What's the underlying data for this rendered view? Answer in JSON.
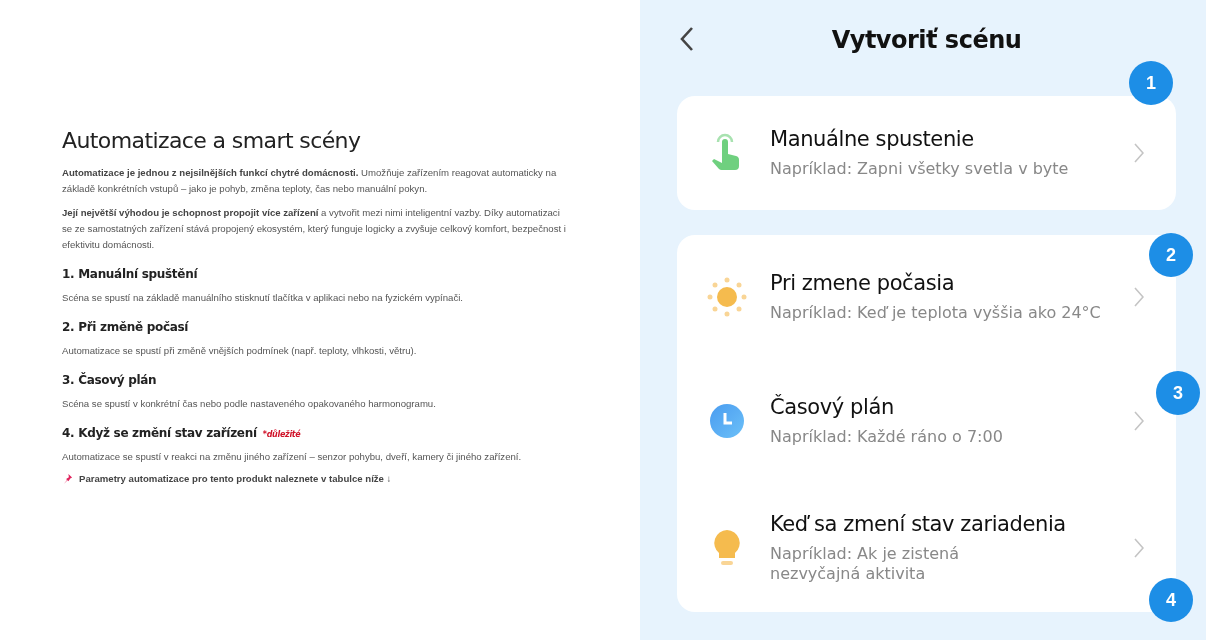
{
  "article": {
    "title": "Automatizace a smart scény",
    "paragraphs": [
      "**Automatizace je jednou z nejsilnějších funkcí chytré domácnosti.** Umožňuje zařízením reagovat automaticky na základě konkrétních vstupů – jako je pohyb, změna teploty, čas nebo manuální pokyn.",
      "**Její největší výhodou je schopnost propojit více zařízení** a vytvořit mezi nimi inteligentní vazby. Díky automatizaci se ze samostatných zařízení stává propojený ekosystém, který funguje logicky a zvyšuje celkový komfort, bezpečnost i efektivitu domácnosti."
    ],
    "sections": [
      {
        "heading": "1. Manuální spuštění",
        "text": "Scéna se spustí na základě manuálního stisknutí tlačítka v aplikaci nebo na fyzickém vypínači."
      },
      {
        "heading": "2. Při změně počasí",
        "text": "Automatizace se spustí při změně vnějších podmínek (např. teploty, vlhkosti, větru)."
      },
      {
        "heading": "3. Časový plán",
        "text": "Scéna se spustí v konkrétní čas nebo podle nastaveného opakovaného harmonogramu."
      },
      {
        "heading": "4. Když se změní stav zařízení",
        "note": "*důležité",
        "text": "Automatizace se spustí v reakci na změnu jiného zařízení – senzor pohybu, dveří, kamery či jiného zařízení."
      }
    ],
    "footer": "Parametry automatizace pro tento produkt naleznete v tabulce níže ↓"
  },
  "phone": {
    "title": "Vytvoriť scénu",
    "cards": [
      {
        "items": [
          {
            "kind": "hand",
            "badge": "1",
            "title": "Manuálne spustenie",
            "example": "Napríklad: Zapni všetky svetla v byte"
          }
        ]
      },
      {
        "items": [
          {
            "kind": "sun",
            "badge": "2",
            "title": "Pri zmene počasia",
            "example": "Napríklad: Keď je teplota vyššia ako 24°C"
          },
          {
            "kind": "clock",
            "badge": "3",
            "title": "Časový plán",
            "example": "Napríklad: Každé ráno o 7:00"
          },
          {
            "kind": "bulb",
            "badge": "4",
            "title": "Keď sa zmení stav zariadenia",
            "example": "Napríklad: Ak je zistená\nnezvyčajná aktivita"
          }
        ]
      }
    ]
  }
}
